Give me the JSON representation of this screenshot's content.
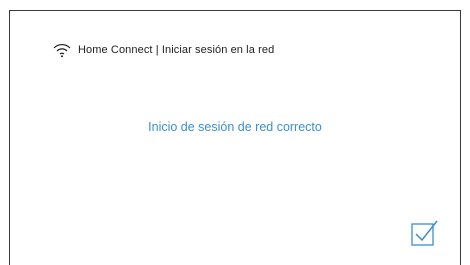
{
  "header": {
    "icon": "wifi-icon",
    "title": "Home Connect | Iniciar sesión en la red"
  },
  "message": {
    "text": "Inicio de sesión de red correcto"
  },
  "confirm": {
    "icon": "checkbox-check-icon"
  },
  "colors": {
    "message": "#3a8fd0",
    "accent": "#3a8fd0",
    "text": "#1e1e1e",
    "border": "#3a3a3a",
    "background": "#ffffff"
  }
}
